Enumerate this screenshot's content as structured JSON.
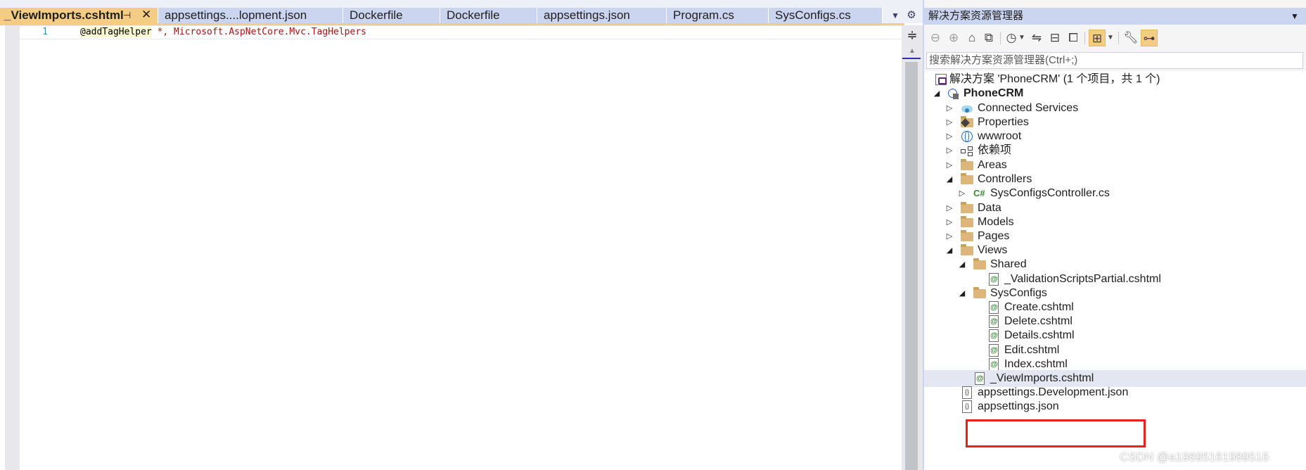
{
  "editor": {
    "tabs": [
      {
        "label": "_ViewImports.cshtml",
        "active": true
      },
      {
        "label": "appsettings....lopment.json"
      },
      {
        "label": "Dockerfile"
      },
      {
        "label": "Dockerfile"
      },
      {
        "label": "appsettings.json"
      },
      {
        "label": "Program.cs"
      },
      {
        "label": "SysConfigs.cs"
      }
    ],
    "tab_pin_icon": "pin-icon",
    "tab_close_icon": "close-icon",
    "line_number": "1",
    "code_directive": "@addTagHelper",
    "code_args": " *, Microsoft.AspNetCore.Mvc.TagHelpers"
  },
  "explorer": {
    "title": "解决方案资源管理器",
    "search_placeholder": "搜索解决方案资源管理器(Ctrl+;)",
    "tree": [
      {
        "label": "解决方案 'PhoneCRM' (1 个项目，共 1 个)",
        "icon": "solution-icon",
        "depth": 0,
        "arrow": ""
      },
      {
        "label": "PhoneCRM",
        "icon": "web-project-icon",
        "depth": 1,
        "arrow": "expanded",
        "bold": true
      },
      {
        "label": "Connected Services",
        "icon": "connected-services-icon",
        "depth": 2,
        "arrow": "collapsed"
      },
      {
        "label": "Properties",
        "icon": "properties-icon",
        "depth": 2,
        "arrow": "collapsed"
      },
      {
        "label": "wwwroot",
        "icon": "globe-icon",
        "depth": 2,
        "arrow": "collapsed"
      },
      {
        "label": "依赖项",
        "icon": "dependencies-icon",
        "depth": 2,
        "arrow": "collapsed"
      },
      {
        "label": "Areas",
        "icon": "folder-icon",
        "depth": 2,
        "arrow": "collapsed"
      },
      {
        "label": "Controllers",
        "icon": "folder-icon",
        "depth": 2,
        "arrow": "expanded"
      },
      {
        "label": "SysConfigsController.cs",
        "icon": "csharp-file-icon",
        "depth": 3,
        "arrow": "collapsed"
      },
      {
        "label": "Data",
        "icon": "folder-icon",
        "depth": 2,
        "arrow": "collapsed"
      },
      {
        "label": "Models",
        "icon": "folder-icon",
        "depth": 2,
        "arrow": "collapsed"
      },
      {
        "label": "Pages",
        "icon": "folder-icon",
        "depth": 2,
        "arrow": "collapsed"
      },
      {
        "label": "Views",
        "icon": "folder-icon",
        "depth": 2,
        "arrow": "expanded"
      },
      {
        "label": "Shared",
        "icon": "folder-icon",
        "depth": 3,
        "arrow": "expanded"
      },
      {
        "label": "_ValidationScriptsPartial.cshtml",
        "icon": "cshtml-file-icon",
        "depth": 4,
        "arrow": ""
      },
      {
        "label": "SysConfigs",
        "icon": "folder-icon",
        "depth": 3,
        "arrow": "expanded"
      },
      {
        "label": "Create.cshtml",
        "icon": "cshtml-file-icon",
        "depth": 4,
        "arrow": ""
      },
      {
        "label": "Delete.cshtml",
        "icon": "cshtml-file-icon",
        "depth": 4,
        "arrow": ""
      },
      {
        "label": "Details.cshtml",
        "icon": "cshtml-file-icon",
        "depth": 4,
        "arrow": ""
      },
      {
        "label": "Edit.cshtml",
        "icon": "cshtml-file-icon",
        "depth": 4,
        "arrow": ""
      },
      {
        "label": "Index.cshtml",
        "icon": "cshtml-file-icon",
        "depth": 4,
        "arrow": ""
      },
      {
        "label": "_ViewImports.cshtml",
        "icon": "cshtml-file-icon",
        "depth": 3,
        "arrow": "",
        "selected": true
      },
      {
        "label": "appsettings.Development.json",
        "icon": "json-file-icon",
        "depth": 2,
        "arrow": ""
      },
      {
        "label": "appsettings.json",
        "icon": "json-file-icon",
        "depth": 2,
        "arrow": ""
      }
    ]
  },
  "watermark": "CSDN @a19895161989516"
}
